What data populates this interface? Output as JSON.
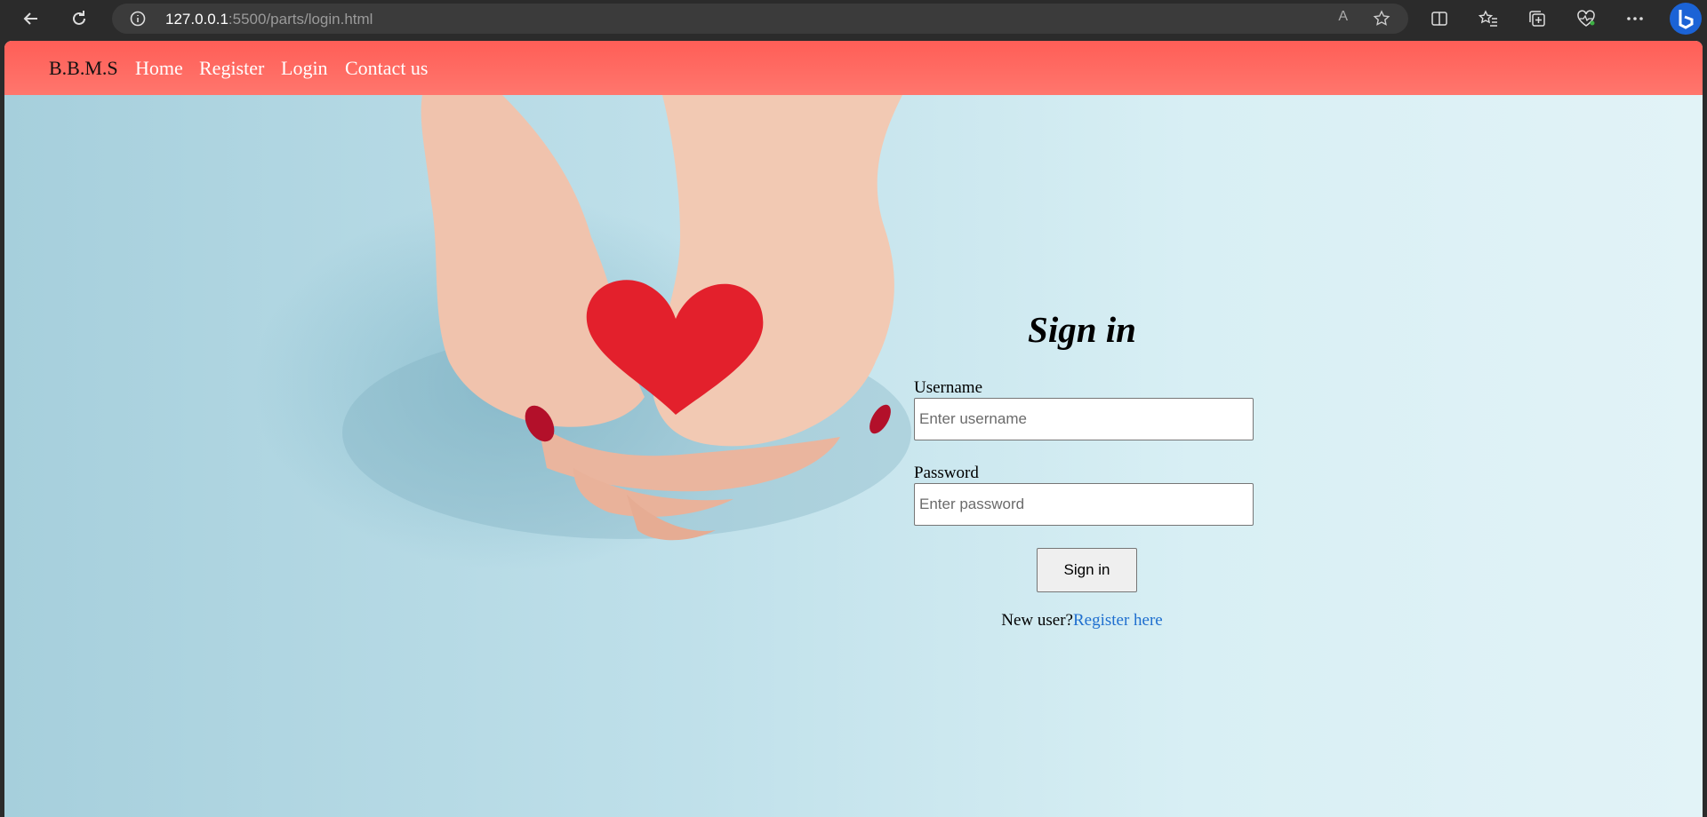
{
  "browser": {
    "url_host": "127.0.0.1",
    "url_path": ":5500/parts/login.html",
    "read_aloud_label": "A"
  },
  "nav": {
    "brand": "B.B.M.S",
    "links": [
      "Home",
      "Register",
      "Login",
      "Contact us"
    ]
  },
  "signin_form": {
    "title": "Sign in",
    "username_label": "Username",
    "username_placeholder": "Enter username",
    "password_label": "Password",
    "password_placeholder": "Enter password",
    "submit_label": "Sign in",
    "new_user_text": "New user?",
    "register_link": "Register here"
  },
  "colors": {
    "navbar": "#ff6a62",
    "link": "#1f6fcf",
    "heart": "#e3202c"
  }
}
